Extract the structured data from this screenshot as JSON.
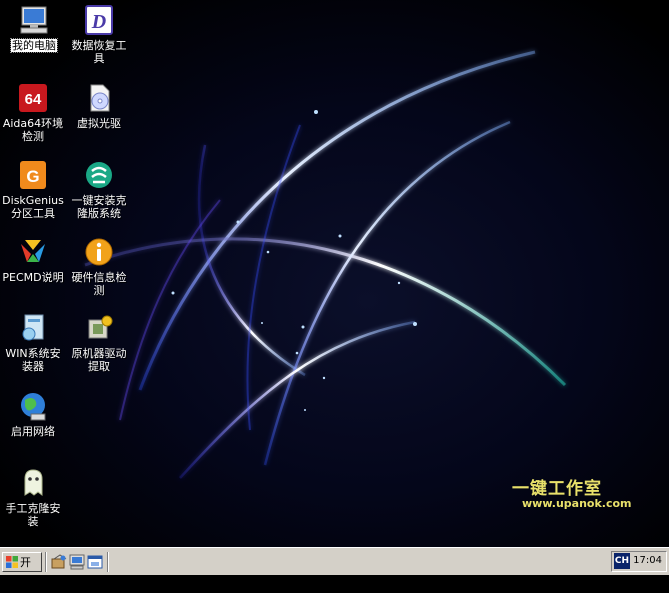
{
  "desktop": {
    "icons": [
      {
        "label": "我的电脑",
        "icon": "my-computer-icon"
      },
      {
        "label": "数据恢复工具",
        "icon": "data-recovery-icon"
      },
      {
        "label": "Aida64环境检测",
        "icon": "aida64-icon",
        "badge": "64"
      },
      {
        "label": "虚拟光驱",
        "icon": "virtual-drive-icon"
      },
      {
        "label": "DiskGenius分区工具",
        "icon": "diskgenius-icon"
      },
      {
        "label": "一键安装克隆版系统",
        "icon": "install-clone-icon"
      },
      {
        "label": "PECMD说明",
        "icon": "pecmd-icon"
      },
      {
        "label": "硬件信息检测",
        "icon": "hardware-info-icon"
      },
      {
        "label": "WIN系统安装器",
        "icon": "win-installer-icon"
      },
      {
        "label": "原机器驱动提取",
        "icon": "driver-extract-icon"
      },
      {
        "label": "启用网络",
        "icon": "network-icon"
      },
      {
        "label": "手工克隆安装",
        "icon": "ghost-icon"
      }
    ],
    "recovery_icon_letter": "D",
    "brand_text": "一键工作室",
    "brand_url": "www.upanok.com"
  },
  "taskbar": {
    "start_label": "开始",
    "quick_launch": [
      "app-icon",
      "computer-icon",
      "window-icon"
    ],
    "language": "CH",
    "clock": "17:04"
  },
  "colors": {
    "taskbar": "#d4d0c8",
    "brand": "#e8e06a",
    "desktop": "#000000"
  }
}
